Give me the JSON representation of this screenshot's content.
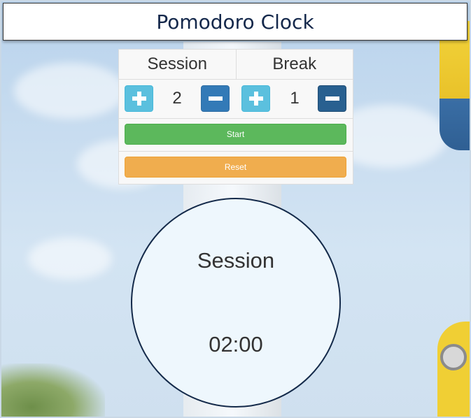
{
  "header": {
    "title": "Pomodoro Clock"
  },
  "settings": {
    "session": {
      "label": "Session",
      "value": "2",
      "increase_icon": "plus-icon",
      "decrease_icon": "minus-icon"
    },
    "break": {
      "label": "Break",
      "value": "1",
      "increase_icon": "plus-icon",
      "decrease_icon": "minus-icon"
    },
    "start_label": "Start",
    "reset_label": "Reset"
  },
  "clock": {
    "mode": "Session",
    "time": "02:00"
  },
  "colors": {
    "header_text": "#14284b",
    "info": "#5bc0de",
    "primary": "#337ab7",
    "success": "#5cb85c",
    "warning": "#f0ad4e"
  }
}
